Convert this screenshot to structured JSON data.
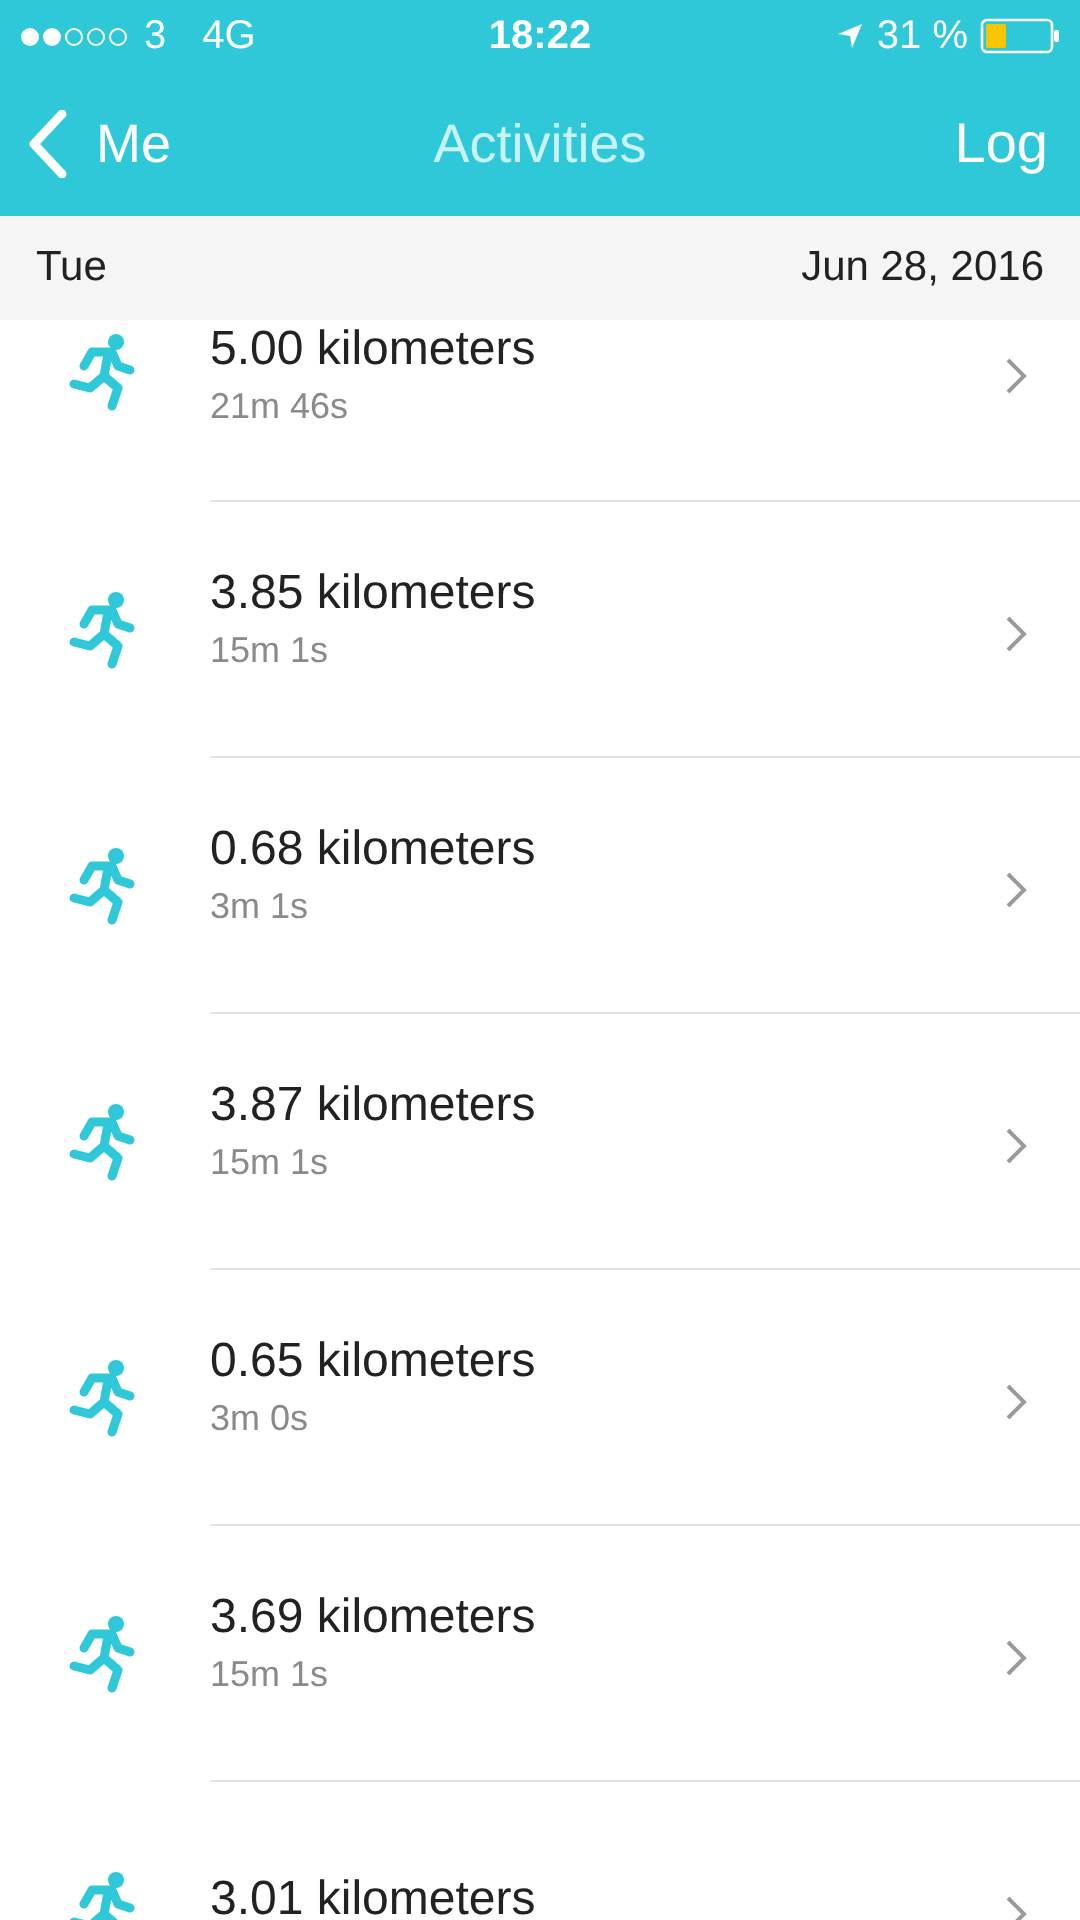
{
  "status_bar": {
    "carrier": "3",
    "network": "4G",
    "time": "18:22",
    "battery": "31 %"
  },
  "nav": {
    "back": "Me",
    "title": "Activities",
    "action": "Log"
  },
  "date_header": {
    "day": "Tue",
    "date": "Jun 28, 2016"
  },
  "activities": [
    {
      "distance": "5.00 kilometers",
      "duration": "21m 46s"
    },
    {
      "distance": "3.85 kilometers",
      "duration": "15m 1s"
    },
    {
      "distance": "0.68 kilometers",
      "duration": "3m 1s"
    },
    {
      "distance": "3.87 kilometers",
      "duration": "15m 1s"
    },
    {
      "distance": "0.65 kilometers",
      "duration": "3m 0s"
    },
    {
      "distance": "3.69 kilometers",
      "duration": "15m 1s"
    },
    {
      "distance": "3.01 kilometers"
    }
  ]
}
